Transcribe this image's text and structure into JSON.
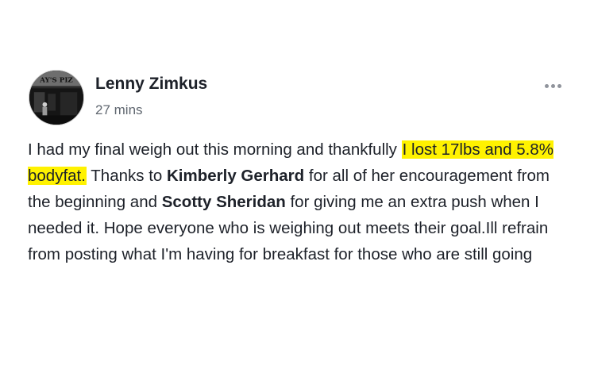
{
  "post": {
    "author": {
      "name": "Lenny Zimkus",
      "avatar_sign_text": "AY'S PIZ",
      "avatar_icon": "profile-photo"
    },
    "timestamp": "27 mins",
    "more_icon": "ellipsis-icon",
    "body": {
      "part1": "I had my final weigh out this morning and thankfully ",
      "highlight": "I lost 17lbs and 5.8% bodyfat.",
      "part2": " Thanks to ",
      "mention1": "Kimberly Gerhard",
      "part3": " for all of her encouragement from the beginning and ",
      "mention2": "Scotty Sheridan",
      "part4": " for giving me an extra push when I needed it. Hope everyone who is weighing out meets their goal.Ill refrain from posting what I'm having for breakfast for those who are still going"
    },
    "colors": {
      "highlight": "#fff200",
      "text": "#1d2129",
      "secondary_text": "#606770",
      "icon": "#90949c"
    }
  }
}
